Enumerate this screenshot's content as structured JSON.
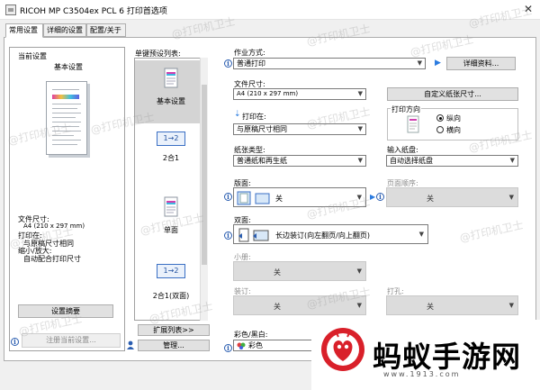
{
  "window": {
    "title": "RICOH MP C3504ex PCL 6 打印首选项",
    "close_glyph": "✕"
  },
  "tabs": [
    {
      "label": "常用设置",
      "active": true
    },
    {
      "label": "详细的设置",
      "active": false
    },
    {
      "label": "配置/关于",
      "active": false
    }
  ],
  "current": {
    "heading": "当前设置",
    "name": "基本设置",
    "summary": [
      {
        "label": "文件尺寸:",
        "value": "A4 (210 x 297 mm)"
      },
      {
        "label": "打印在:",
        "value": "与原稿尺寸相同"
      },
      {
        "label": "缩小/放大:",
        "value": "自动配合打印尺寸"
      }
    ],
    "summary_button": "设置摘要",
    "register_button": "注册当前设置..."
  },
  "presets": {
    "heading": "单键预设列表:",
    "items": [
      {
        "label": "基本设置",
        "selected": true,
        "icon": "document-icon"
      },
      {
        "label": "2合1",
        "selected": false,
        "icon": "two-in-one-icon"
      },
      {
        "label": "单面",
        "selected": false,
        "icon": "document-icon"
      },
      {
        "label": "2合1(双面)",
        "selected": false,
        "icon": "two-in-one-icon"
      }
    ],
    "badge": "1→2",
    "expand_button": "扩展列表>>",
    "manage_button": "管理..."
  },
  "settings": {
    "job_type_label": "作业方式:",
    "job_type_value": "普通打印",
    "details_button": "详细资料...",
    "paper_size_label": "文件尺寸:",
    "paper_size_value": "A4 (210 x 297 mm)",
    "custom_paper_button": "自定义纸张尺寸...",
    "print_on_label": "打印在:",
    "print_on_value": "与原稿尺寸相同",
    "orientation_label": "打印方向",
    "orientation_portrait": "纵向",
    "orientation_landscape": "横向",
    "paper_type_label": "纸张类型:",
    "paper_type_value": "普通纸和再生纸",
    "input_tray_label": "输入纸盘:",
    "input_tray_value": "自动选择纸盘",
    "layout_label": "版面:",
    "layout_value": "关",
    "page_order_label": "页面顺序:",
    "page_order_value": "关",
    "duplex_label": "双面:",
    "duplex_value": "长边装订(向左翻页/向上翻页)",
    "booklet_label": "小册:",
    "booklet_value": "关",
    "staple_label": "装订:",
    "staple_value": "关",
    "punch_label": "打孔:",
    "punch_value": "关",
    "color_label": "彩色/黑白:",
    "color_value": "彩色"
  },
  "watermark_text": "@打印机卫士",
  "logo": {
    "text": "蚂蚁手游网",
    "sub": "www.1913.com"
  },
  "colors": {
    "accent": "#2a5db0",
    "logo_red": "#d9202a"
  }
}
